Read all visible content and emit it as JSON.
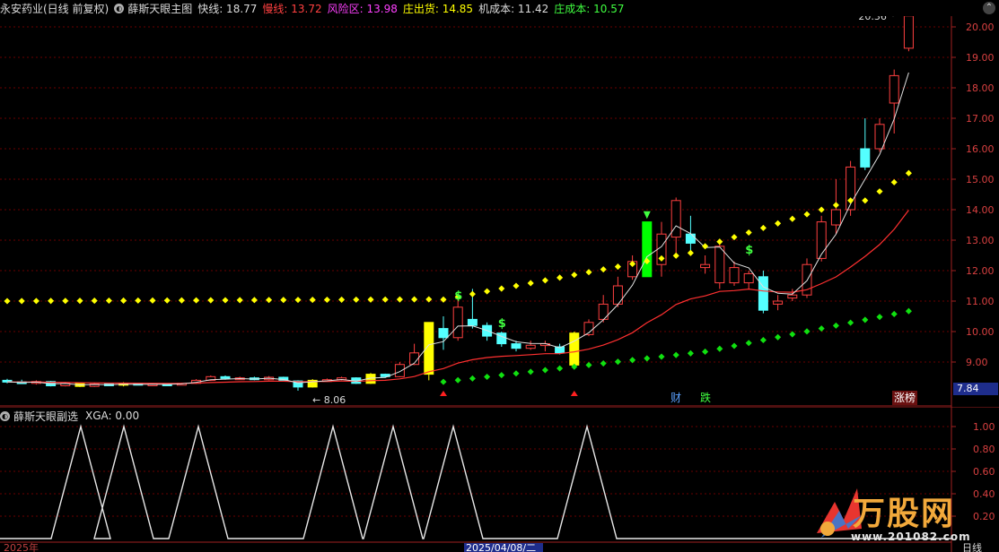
{
  "header": {
    "stock_name": "永安药业(日线 前复权)",
    "indicator_name": "薛斯天眼主图",
    "indicators": [
      {
        "label": "快线: 18.77",
        "color": "#dcdcdc"
      },
      {
        "label": "慢线: 13.72",
        "color": "#ff4040"
      },
      {
        "label": "风险区: 13.98",
        "color": "#ff40ff"
      },
      {
        "label": "庄出货: 14.85",
        "color": "#ffff00"
      },
      {
        "label": "机成本: 11.42",
        "color": "#dcdcdc"
      },
      {
        "label": "庄成本: 10.57",
        "color": "#40ff40"
      }
    ]
  },
  "main_axis": {
    "ticks": [
      "20.00",
      "19.00",
      "18.00",
      "17.00",
      "16.00",
      "15.00",
      "14.00",
      "13.00",
      "12.00",
      "11.00",
      "10.00",
      "9.00"
    ],
    "current_price": "7.84"
  },
  "annotations": {
    "high_label": "20.36",
    "low_label": "8.06",
    "marker_cai": "财",
    "marker_die": "跌",
    "marker_zhangbang": "涨榜",
    "dollar_sign": "$"
  },
  "sub_panel": {
    "title": "薛斯天眼副选",
    "value_label": "XGA: 0.00",
    "ticks": [
      "1.00",
      "0.80",
      "0.60",
      "0.40",
      "0.20"
    ],
    "date_label": "2025/04/08/二",
    "period_label": "日线",
    "start_label": "2025年"
  },
  "watermark": {
    "brand": "万股网",
    "url": "www.201082.com"
  },
  "colors": {
    "up": "#ff4040",
    "down": "#54ffff",
    "yellow": "#ffff00",
    "green": "#00ff00",
    "grid": "#8b0000"
  },
  "chart_data": {
    "type": "candlestick",
    "x": [
      1,
      2,
      3,
      4,
      5,
      6,
      7,
      8,
      9,
      10,
      11,
      12,
      13,
      14,
      15,
      16,
      17,
      18,
      19,
      20,
      21,
      22,
      23,
      24,
      25,
      26,
      27,
      28,
      29,
      30,
      31,
      32,
      33,
      34,
      35,
      36,
      37,
      38,
      39,
      40,
      41,
      42,
      43,
      44,
      45,
      46,
      47,
      48,
      49,
      50,
      51,
      52,
      53,
      54,
      55,
      56,
      57,
      58,
      59,
      60,
      61,
      62
    ],
    "candles": [
      {
        "o": 8.4,
        "c": 8.35,
        "h": 8.45,
        "l": 8.3,
        "k": "down"
      },
      {
        "o": 8.35,
        "c": 8.3,
        "h": 8.42,
        "l": 8.28,
        "k": "down"
      },
      {
        "o": 8.3,
        "c": 8.36,
        "h": 8.4,
        "l": 8.26,
        "k": "up"
      },
      {
        "o": 8.36,
        "c": 8.22,
        "h": 8.38,
        "l": 8.2,
        "k": "down"
      },
      {
        "o": 8.22,
        "c": 8.3,
        "h": 8.34,
        "l": 8.2,
        "k": "up"
      },
      {
        "o": 8.3,
        "c": 8.2,
        "h": 8.34,
        "l": 8.18,
        "k": "yellow"
      },
      {
        "o": 8.2,
        "c": 8.28,
        "h": 8.32,
        "l": 8.18,
        "k": "up"
      },
      {
        "o": 8.28,
        "c": 8.24,
        "h": 8.3,
        "l": 8.22,
        "k": "down"
      },
      {
        "o": 8.24,
        "c": 8.3,
        "h": 8.34,
        "l": 8.2,
        "k": "yellow"
      },
      {
        "o": 8.3,
        "c": 8.26,
        "h": 8.32,
        "l": 8.24,
        "k": "down"
      },
      {
        "o": 8.26,
        "c": 8.28,
        "h": 8.3,
        "l": 8.24,
        "k": "up"
      },
      {
        "o": 8.28,
        "c": 8.26,
        "h": 8.3,
        "l": 8.24,
        "k": "down"
      },
      {
        "o": 8.26,
        "c": 8.3,
        "h": 8.32,
        "l": 8.24,
        "k": "up"
      },
      {
        "o": 8.3,
        "c": 8.4,
        "h": 8.44,
        "l": 8.28,
        "k": "up"
      },
      {
        "o": 8.4,
        "c": 8.52,
        "h": 8.56,
        "l": 8.38,
        "k": "up"
      },
      {
        "o": 8.52,
        "c": 8.46,
        "h": 8.56,
        "l": 8.42,
        "k": "down"
      },
      {
        "o": 8.46,
        "c": 8.48,
        "h": 8.52,
        "l": 8.44,
        "k": "up"
      },
      {
        "o": 8.48,
        "c": 8.42,
        "h": 8.52,
        "l": 8.4,
        "k": "down"
      },
      {
        "o": 8.42,
        "c": 8.5,
        "h": 8.54,
        "l": 8.4,
        "k": "up"
      },
      {
        "o": 8.5,
        "c": 8.38,
        "h": 8.52,
        "l": 8.36,
        "k": "down"
      },
      {
        "o": 8.38,
        "c": 8.18,
        "h": 8.4,
        "l": 8.06,
        "k": "down"
      },
      {
        "o": 8.18,
        "c": 8.4,
        "h": 8.44,
        "l": 8.16,
        "k": "yellow"
      },
      {
        "o": 8.4,
        "c": 8.42,
        "h": 8.46,
        "l": 8.38,
        "k": "up"
      },
      {
        "o": 8.42,
        "c": 8.48,
        "h": 8.52,
        "l": 8.4,
        "k": "up"
      },
      {
        "o": 8.48,
        "c": 8.3,
        "h": 8.5,
        "l": 8.28,
        "k": "down"
      },
      {
        "o": 8.3,
        "c": 8.6,
        "h": 8.64,
        "l": 8.28,
        "k": "yellow"
      },
      {
        "o": 8.6,
        "c": 8.52,
        "h": 8.62,
        "l": 8.48,
        "k": "down"
      },
      {
        "o": 8.52,
        "c": 8.92,
        "h": 9.0,
        "l": 8.5,
        "k": "up"
      },
      {
        "o": 8.92,
        "c": 9.3,
        "h": 9.6,
        "l": 8.9,
        "k": "up"
      },
      {
        "o": 8.6,
        "c": 10.3,
        "h": 10.3,
        "l": 8.4,
        "k": "yellow"
      },
      {
        "o": 10.1,
        "c": 9.8,
        "h": 10.5,
        "l": 9.4,
        "k": "down"
      },
      {
        "o": 9.8,
        "c": 10.8,
        "h": 11.2,
        "l": 9.7,
        "k": "up"
      },
      {
        "o": 10.4,
        "c": 10.2,
        "h": 11.4,
        "l": 10.1,
        "k": "down"
      },
      {
        "o": 10.2,
        "c": 9.85,
        "h": 10.3,
        "l": 9.7,
        "k": "down"
      },
      {
        "o": 9.95,
        "c": 9.6,
        "h": 10.0,
        "l": 9.5,
        "k": "down"
      },
      {
        "o": 9.6,
        "c": 9.45,
        "h": 9.7,
        "l": 9.35,
        "k": "down"
      },
      {
        "o": 9.45,
        "c": 9.55,
        "h": 9.7,
        "l": 9.4,
        "k": "up"
      },
      {
        "o": 9.55,
        "c": 9.6,
        "h": 9.7,
        "l": 9.35,
        "k": "up"
      },
      {
        "o": 9.5,
        "c": 9.3,
        "h": 9.6,
        "l": 9.25,
        "k": "down"
      },
      {
        "o": 8.9,
        "c": 9.95,
        "h": 10.0,
        "l": 8.8,
        "k": "yellow"
      },
      {
        "o": 9.9,
        "c": 10.3,
        "h": 10.4,
        "l": 9.85,
        "k": "up"
      },
      {
        "o": 10.4,
        "c": 10.9,
        "h": 11.2,
        "l": 10.3,
        "k": "up"
      },
      {
        "o": 10.9,
        "c": 11.5,
        "h": 11.8,
        "l": 10.8,
        "k": "up"
      },
      {
        "o": 11.8,
        "c": 12.3,
        "h": 12.5,
        "l": 11.7,
        "k": "up"
      },
      {
        "o": 11.8,
        "c": 13.6,
        "h": 13.6,
        "l": 11.8,
        "k": "green"
      },
      {
        "o": 12.2,
        "c": 13.2,
        "h": 13.6,
        "l": 11.8,
        "k": "up"
      },
      {
        "o": 13.1,
        "c": 14.3,
        "h": 14.4,
        "l": 12.5,
        "k": "up"
      },
      {
        "o": 13.2,
        "c": 12.9,
        "h": 13.8,
        "l": 12.6,
        "k": "down"
      },
      {
        "o": 12.1,
        "c": 12.2,
        "h": 12.5,
        "l": 11.9,
        "k": "up"
      },
      {
        "o": 11.6,
        "c": 12.8,
        "h": 12.9,
        "l": 11.4,
        "k": "up"
      },
      {
        "o": 12.1,
        "c": 11.6,
        "h": 12.3,
        "l": 11.5,
        "k": "up"
      },
      {
        "o": 11.6,
        "c": 11.9,
        "h": 12.0,
        "l": 11.4,
        "k": "up"
      },
      {
        "o": 11.8,
        "c": 10.7,
        "h": 12.0,
        "l": 10.6,
        "k": "down"
      },
      {
        "o": 10.9,
        "c": 11.0,
        "h": 11.2,
        "l": 10.7,
        "k": "up"
      },
      {
        "o": 11.1,
        "c": 11.2,
        "h": 11.4,
        "l": 11.0,
        "k": "up"
      },
      {
        "o": 11.2,
        "c": 12.2,
        "h": 12.4,
        "l": 11.1,
        "k": "up"
      },
      {
        "o": 12.4,
        "c": 13.6,
        "h": 13.8,
        "l": 12.3,
        "k": "up"
      },
      {
        "o": 13.5,
        "c": 14.0,
        "h": 15.0,
        "l": 13.2,
        "k": "up"
      },
      {
        "o": 14.0,
        "c": 15.4,
        "h": 15.6,
        "l": 13.8,
        "k": "up"
      },
      {
        "o": 15.4,
        "c": 16.0,
        "h": 17.0,
        "l": 15.3,
        "k": "down"
      },
      {
        "o": 16.0,
        "c": 16.8,
        "h": 17.0,
        "l": 15.9,
        "k": "up"
      },
      {
        "o": 17.5,
        "c": 18.4,
        "h": 18.6,
        "l": 16.5,
        "k": "up"
      },
      {
        "o": 19.3,
        "c": 20.36,
        "h": 20.36,
        "l": 19.2,
        "k": "up"
      }
    ]
  }
}
